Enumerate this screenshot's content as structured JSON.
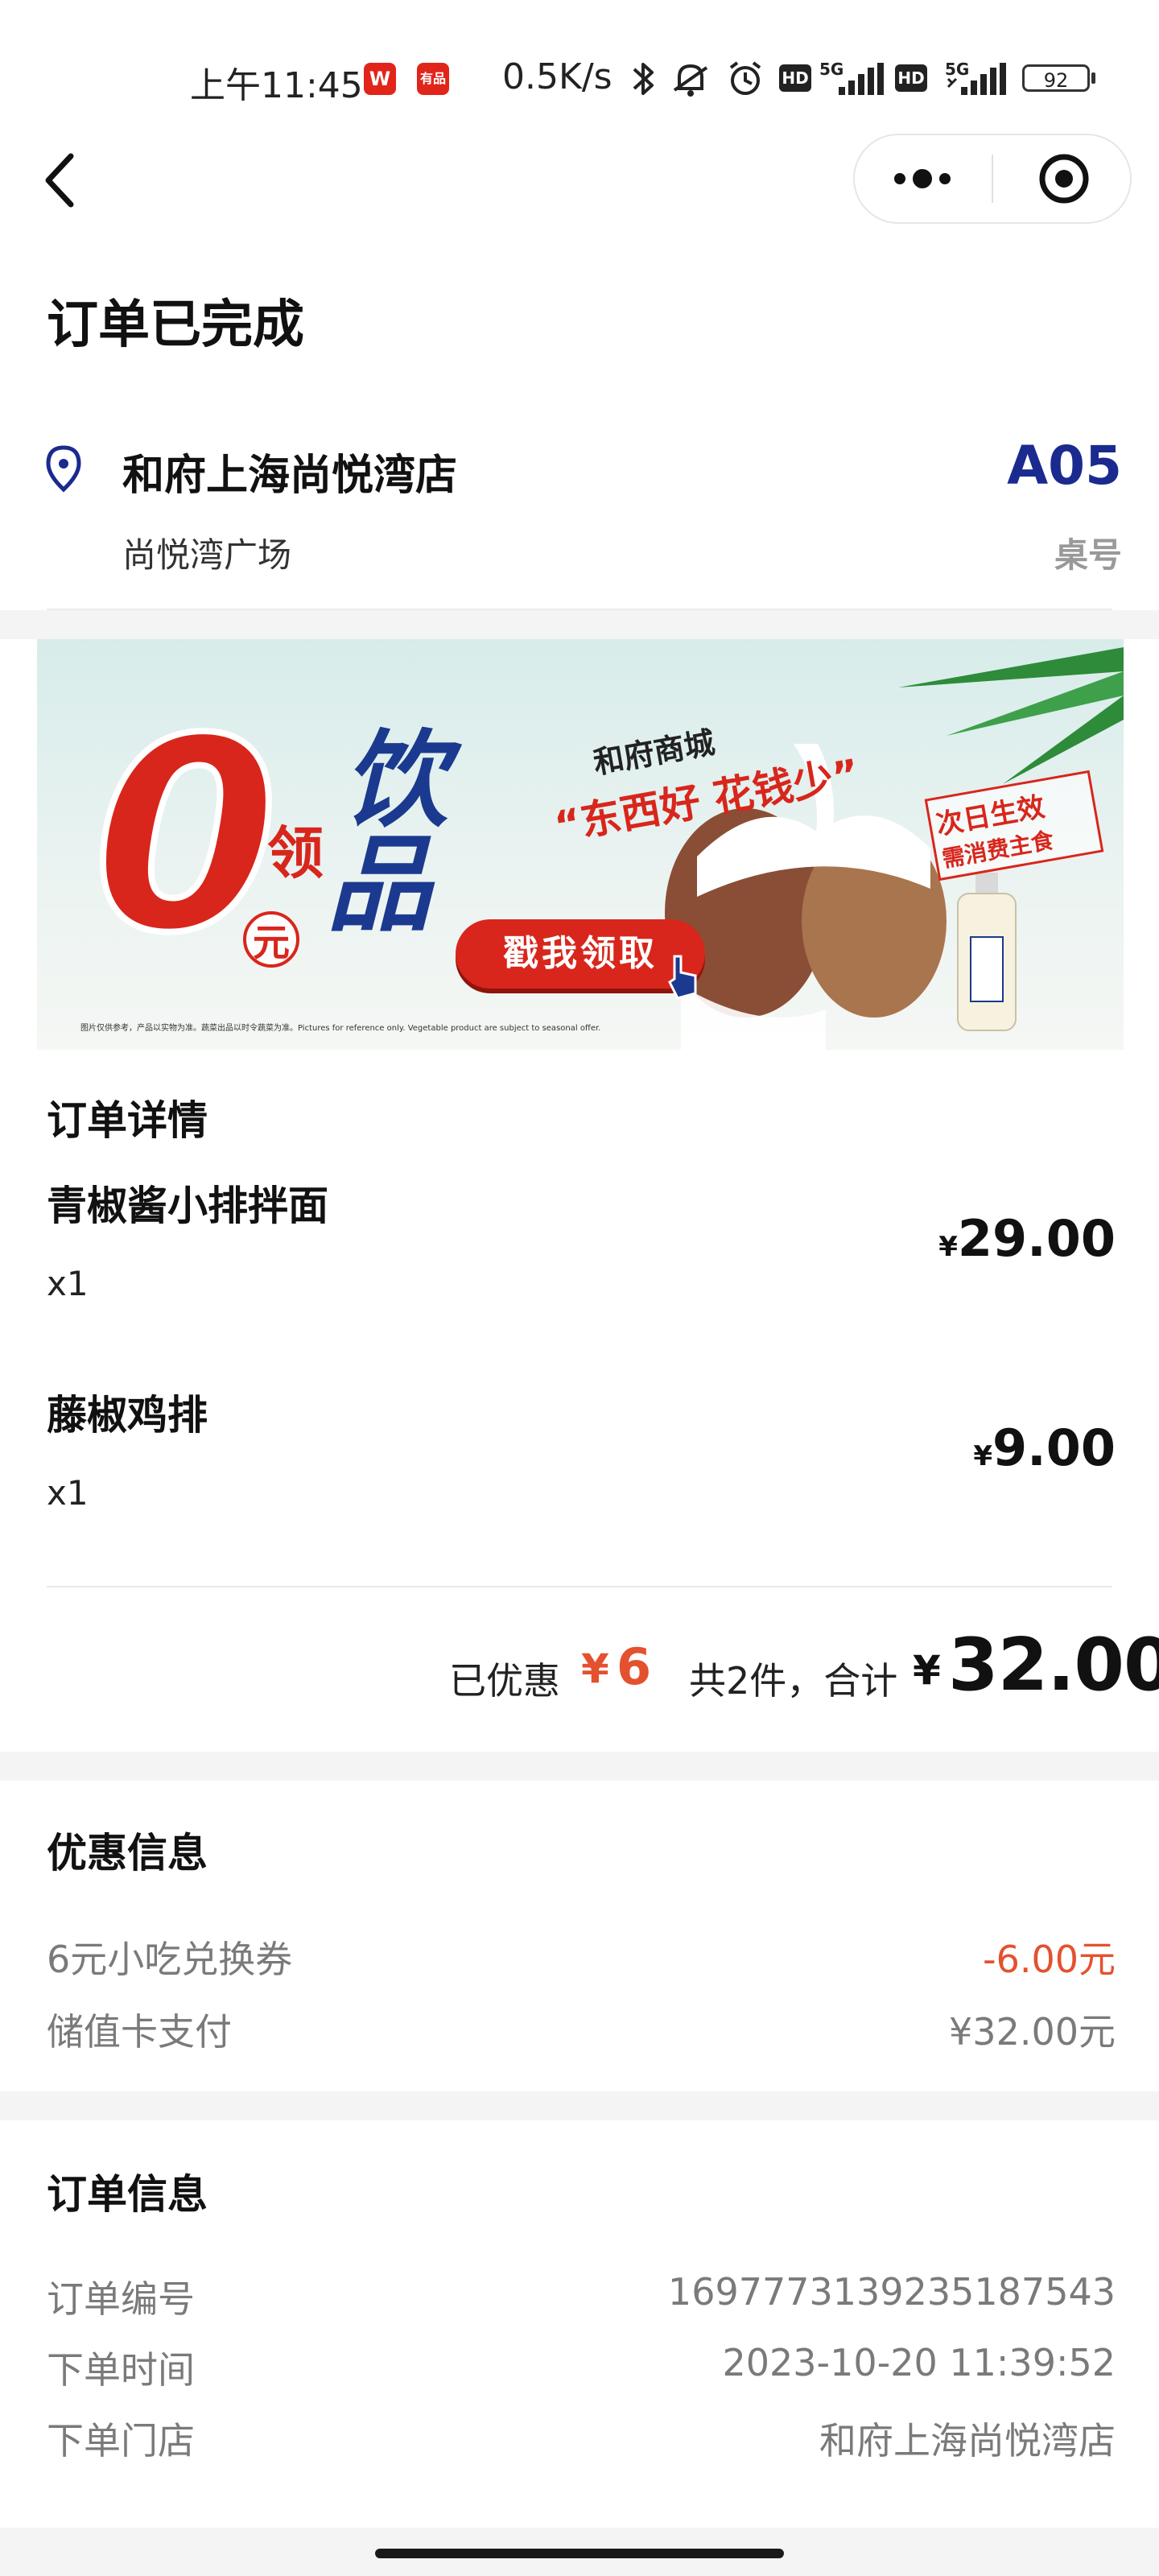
{
  "status_bar": {
    "time": "上午11:45",
    "app_badge_1": "W",
    "app_badge_2": "有品",
    "net_speed": "0.5K/s",
    "hd_1": "HD",
    "sig_1": "5G",
    "hd_2": "HD",
    "sig_2": "5G",
    "battery": "92"
  },
  "header": {
    "title": "订单已完成"
  },
  "store": {
    "name": "和府上海尚悦湾店",
    "location": "尚悦湾广场",
    "table_number": "A05",
    "table_label": "桌号"
  },
  "banner": {
    "big_zero": "0",
    "yuan": "元",
    "ling": "领",
    "drink_1": "饮",
    "drink_2": "品",
    "mall_name": "和府商城",
    "slogan": "“东西好 花钱少”",
    "effect_1": "次日生效",
    "effect_2": "需消费主食",
    "cta": "戳我领取",
    "disclaimer": "图片仅供参考，产品以实物为准。蔬菜出品以时令蔬菜为准。Pictures for reference only. Vegetable product are subject to seasonal offer."
  },
  "order_details": {
    "title": "订单详情",
    "items": [
      {
        "name": "青椒酱小排拌面",
        "qty": "x1",
        "currency": "¥",
        "price": "29.00"
      },
      {
        "name": "藤椒鸡排",
        "qty": "x1",
        "currency": "¥",
        "price": "9.00"
      }
    ],
    "discount_label": "已优惠",
    "discount_currency": "¥",
    "discount_value": "6",
    "total_label": "共2件，合计",
    "total_currency": "¥",
    "total_value": "32.00"
  },
  "discount_info": {
    "title": "优惠信息",
    "rows": [
      {
        "label": "6元小吃兑换券",
        "value": "-6.00元"
      },
      {
        "label": "储值卡支付",
        "value": "¥32.00元"
      }
    ]
  },
  "order_info": {
    "title": "订单信息",
    "rows": [
      {
        "label": "订单编号",
        "value": "1697773139235187543"
      },
      {
        "label": "下单时间",
        "value": "2023-10-20 11:39:52"
      },
      {
        "label": "下单门店",
        "value": "和府上海尚悦湾店"
      }
    ]
  },
  "colors": {
    "accent_red": "#e4512f",
    "table_blue": "#1a2a8f",
    "banner_red": "#d8261c",
    "banner_blue": "#1b3a8f"
  }
}
